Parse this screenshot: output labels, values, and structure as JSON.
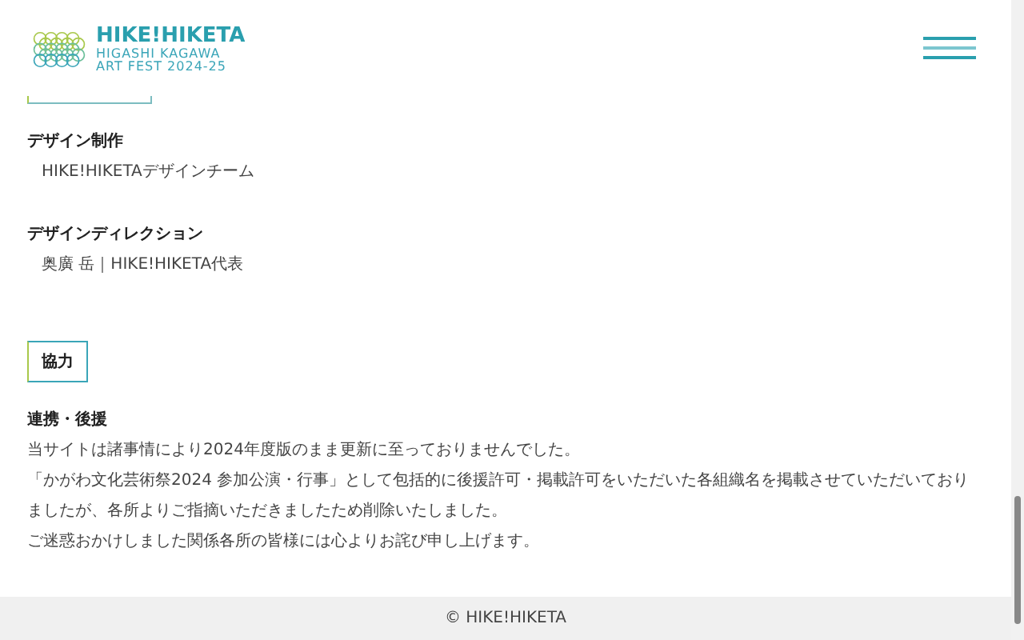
{
  "header": {
    "logo": {
      "title": "HIKE!HIKETA",
      "subtitle_1": "HIGASHI KAGAWA",
      "subtitle_2": "ART FEST 2024-25"
    }
  },
  "credits": [
    {
      "heading": "デザイン制作",
      "value": "HIKE!HIKETAデザインチーム"
    },
    {
      "heading": "デザインディレクション",
      "value": "奥廣 岳｜HIKE!HIKETA代表"
    }
  ],
  "section_tag": "協力",
  "cooperation": {
    "heading": "連携・後援",
    "lines": [
      "当サイトは諸事情により2024年度版のまま更新に至っておりませんでした。",
      "「かがわ文化芸術祭2024 参加公演・行事」として包括的に後援許可・掲載許可をいただいた各組織名を掲載させていただいておりましたが、各所よりご指摘いただきましたため削除いたしました。",
      "ご迷惑おかけしました関係各所の皆様には心よりお詫び申し上げます。"
    ]
  },
  "footer": {
    "copyright": "© HIKE!HIKETA"
  }
}
